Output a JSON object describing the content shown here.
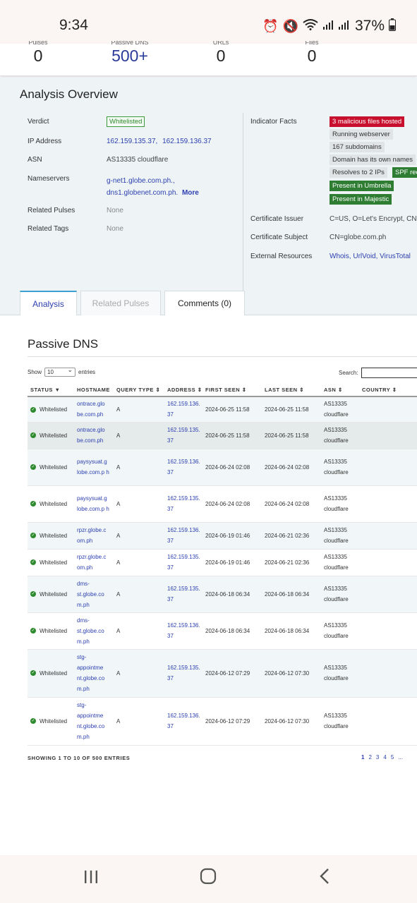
{
  "status_bar": {
    "time": "9:34",
    "battery": "37%"
  },
  "stats": [
    {
      "label": "Pulses",
      "value": "0",
      "accent": false
    },
    {
      "label": "Passive DNS",
      "value": "500+",
      "accent": true
    },
    {
      "label": "URLs",
      "value": "0",
      "accent": false
    },
    {
      "label": "Files",
      "value": "0",
      "accent": false
    }
  ],
  "overview": {
    "title": "Analysis Overview",
    "verdict_label": "Verdict",
    "verdict_value": "Whitelisted",
    "ip_label": "IP Address",
    "ip_1": "162.159.135.37,",
    "ip_2": "162.159.136.37",
    "asn_label": "ASN",
    "asn_value": "AS13335 cloudflare",
    "ns_label": "Nameservers",
    "ns_1": "g-net1.globe.com.ph.,",
    "ns_2": "dns1.globenet.com.ph.",
    "ns_more": "More",
    "pulses_label": "Related Pulses",
    "pulses_value": "None",
    "tags_label": "Related Tags",
    "tags_value": "None",
    "facts_label": "Indicator Facts",
    "facts": [
      {
        "text": "3 malicious files hosted",
        "color": "#c8102e"
      },
      {
        "text": "Running webserver",
        "color": "#e1e4e6"
      },
      {
        "text": "167 subdomains",
        "color": "#e1e4e6"
      },
      {
        "text": "Domain has its own names",
        "color": "#e1e4e6"
      },
      {
        "text": "Resolves to 2 IPs",
        "color": "#e1e4e6"
      },
      {
        "text": "SPF rec",
        "color": "#2e7d32"
      },
      {
        "text": "Present in Umbrella",
        "color": "#2e7d32"
      },
      {
        "text": "Present in Majestic",
        "color": "#2e7d32"
      }
    ],
    "cert_issuer_label": "Certificate Issuer",
    "cert_issuer_value": "C=US, O=Let's Encrypt, CN=",
    "cert_subject_label": "Certificate Subject",
    "cert_subject_value": "CN=globe.com.ph",
    "ext_label": "External Resources",
    "ext_links": [
      "Whois",
      "UrlVoid",
      "VirusTotal"
    ]
  },
  "tabs": [
    "Analysis",
    "Related Pulses",
    "Comments (0)"
  ],
  "passive_dns": {
    "title": "Passive DNS",
    "show_label": "Show",
    "show_value": "10",
    "entries_label": "entries",
    "search_label": "Search:",
    "columns": [
      "STATUS",
      "HOSTNAME",
      "QUERY TYPE",
      "ADDRESS",
      "FIRST SEEN",
      "LAST SEEN",
      "ASN",
      "COUNTRY"
    ],
    "rows": [
      {
        "status": "Whitelisted",
        "hostname": "ontrace.glo be.com.ph",
        "type": "A",
        "address": "162.159.136. 37",
        "first": "2024-06-25 11:58",
        "last": "2024-06-25 11:58",
        "asn": "AS13335 cloudflare",
        "country": ""
      },
      {
        "status": "Whitelisted",
        "hostname": "ontrace.glo be.com.ph",
        "type": "A",
        "address": "162.159.135. 37",
        "first": "2024-06-25 11:58",
        "last": "2024-06-25 11:58",
        "asn": "AS13335 cloudflare",
        "country": ""
      },
      {
        "status": "Whitelisted",
        "hostname": "paysysuat.g lobe.com.p h",
        "type": "A",
        "address": "162.159.136. 37",
        "first": "2024-06-24 02:08",
        "last": "2024-06-24 02:08",
        "asn": "AS13335 cloudflare",
        "country": ""
      },
      {
        "status": "Whitelisted",
        "hostname": "paysysuat.g lobe.com.p h",
        "type": "A",
        "address": "162.159.135. 37",
        "first": "2024-06-24 02:08",
        "last": "2024-06-24 02:08",
        "asn": "AS13335 cloudflare",
        "country": ""
      },
      {
        "status": "Whitelisted",
        "hostname": "rpzr.globe.c om.ph",
        "type": "A",
        "address": "162.159.136. 37",
        "first": "2024-06-19 01:46",
        "last": "2024-06-21 02:36",
        "asn": "AS13335 cloudflare",
        "country": ""
      },
      {
        "status": "Whitelisted",
        "hostname": "rpzr.globe.c om.ph",
        "type": "A",
        "address": "162.159.135. 37",
        "first": "2024-06-19 01:46",
        "last": "2024-06-21 02:36",
        "asn": "AS13335 cloudflare",
        "country": ""
      },
      {
        "status": "Whitelisted",
        "hostname": "dms- st.globe.co m.ph",
        "type": "A",
        "address": "162.159.135. 37",
        "first": "2024-06-18 06:34",
        "last": "2024-06-18 06:34",
        "asn": "AS13335 cloudflare",
        "country": ""
      },
      {
        "status": "Whitelisted",
        "hostname": "dms- st.globe.co m.ph",
        "type": "A",
        "address": "162.159.136. 37",
        "first": "2024-06-18 06:34",
        "last": "2024-06-18 06:34",
        "asn": "AS13335 cloudflare",
        "country": ""
      },
      {
        "status": "Whitelisted",
        "hostname": "stg- appointme nt.globe.co m.ph",
        "type": "A",
        "address": "162.159.135. 37",
        "first": "2024-06-12 07:29",
        "last": "2024-06-12 07:30",
        "asn": "AS13335 cloudflare",
        "country": ""
      },
      {
        "status": "Whitelisted",
        "hostname": "stg- appointme nt.globe.co m.ph",
        "type": "A",
        "address": "162.159.136. 37",
        "first": "2024-06-12 07:29",
        "last": "2024-06-12 07:30",
        "asn": "AS13335 cloudflare",
        "country": ""
      }
    ],
    "entries_info": "SHOWING 1 TO 10 OF 500 ENTRIES",
    "pages": [
      "1",
      "2",
      "3",
      "4",
      "5",
      "..."
    ]
  }
}
